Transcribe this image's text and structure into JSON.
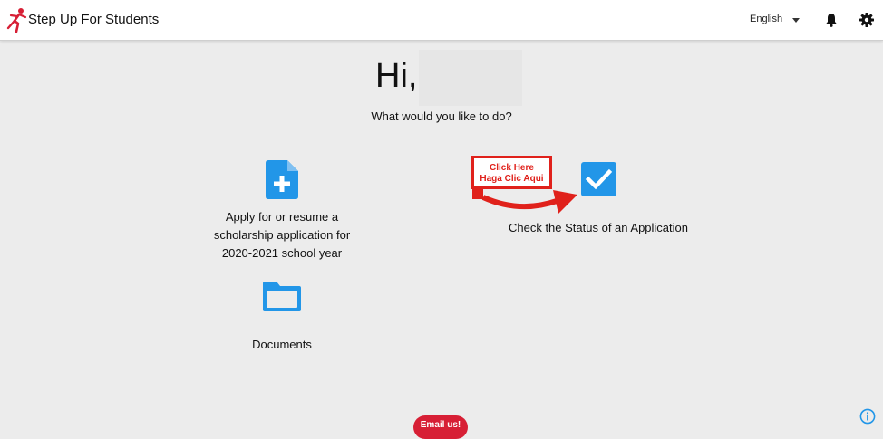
{
  "header": {
    "brand": "Step Up For Students",
    "language": "English"
  },
  "main": {
    "greeting": "Hi,",
    "prompt": "What would you like to do?",
    "apply": {
      "lines": [
        "Apply for or resume a",
        "scholarship application for",
        "2020-2021 school year"
      ]
    },
    "status": {
      "label": "Check the Status of an Application"
    },
    "documents": {
      "label": "Documents"
    },
    "callout": {
      "line1": "Click Here",
      "line2": "Haga Clic Aqui"
    }
  },
  "footer": {
    "email_button": "Email us!"
  },
  "colors": {
    "accent_blue": "#2296e8",
    "brand_red": "#d71f35",
    "callout_red": "#e0211b"
  },
  "icons": [
    "runner-logo-icon",
    "caret-down-icon",
    "bell-icon",
    "gear-icon",
    "document-plus-icon",
    "checkbox-icon",
    "folder-icon",
    "info-icon",
    "red-arrow"
  ]
}
